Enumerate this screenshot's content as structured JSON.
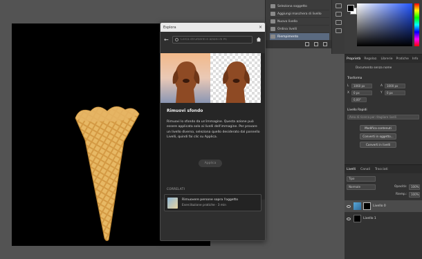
{
  "history": {
    "items": [
      {
        "label": "Seleziona soggetto",
        "active": false
      },
      {
        "label": "Aggiungi maschera di livello",
        "active": false
      },
      {
        "label": "Nuovo livello",
        "active": false
      },
      {
        "label": "Ordina livelli",
        "active": false
      },
      {
        "label": "Riempimento",
        "active": true
      }
    ]
  },
  "properties": {
    "tabs": [
      "Proprietà",
      "Regolaz.",
      "Librerie",
      "Pratiche",
      "Info"
    ],
    "doc_label": "Documento senza nome",
    "section_transform": "Trasforma",
    "w_label": "L",
    "w_value": "1060 px",
    "h_label": "A",
    "h_value": "1000 px",
    "x_label": "X",
    "x_value": "0 px",
    "y_label": "Y",
    "y_value": "0 px",
    "angle_value": "0,00°",
    "quick_actions_label": "Livello Rapidi",
    "quick_actions_search": "Area di ricerca per ritagliare livelli",
    "btn_1": "Modifica contenuti",
    "btn_2": "Converti in oggetto...",
    "btn_3": "Converti in livelli"
  },
  "layers": {
    "tabs": [
      "Livelli",
      "Canali",
      "Tracciati"
    ],
    "filter_value": "Tipo",
    "blend_value": "Normale",
    "opacity_label": "Opacità:",
    "opacity_value": "100%",
    "fill_label": "Riemp.:",
    "fill_value": "100%",
    "rows": [
      {
        "name": "Livello 0"
      },
      {
        "name": "Livello 1"
      }
    ]
  },
  "discover": {
    "title": "Esplora",
    "close_glyph": "×",
    "back_glyph": "←",
    "search_placeholder": "Cerca strumenti e azioni di Ps",
    "card_title": "Rimuovi sfondo",
    "card_body": "Rimuovi lo sfondo da un'immagine. Questa azione può essere applicata solo ai livelli dell'immagine. Per provare un livello diverso, seleziona quello desiderato dal pannello Livelli, quindi fai clic su Applica.",
    "apply_label": "Applica",
    "section_label": "CORRELATI",
    "related_title": "Rimuovere persone sopra l'oggetto",
    "related_meta": "Esercitazione pratiche · 3 min"
  }
}
